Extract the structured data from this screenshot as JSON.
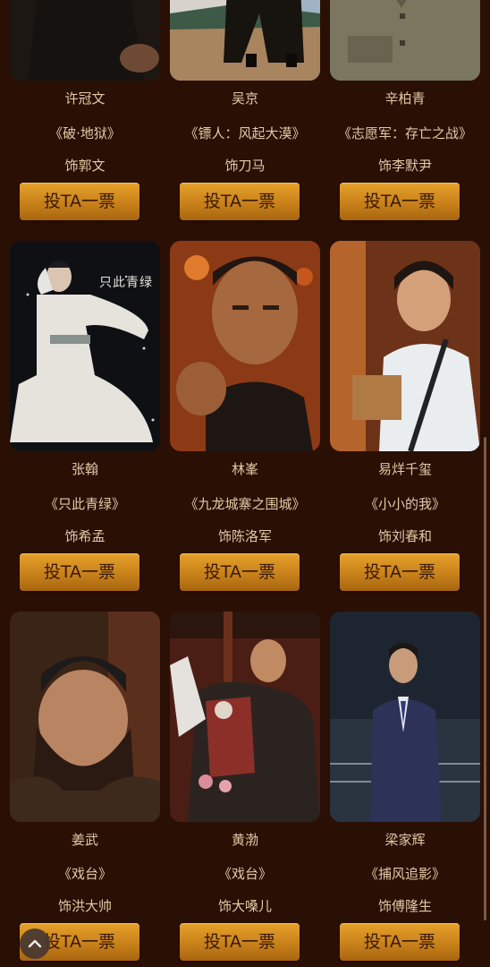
{
  "vote_label": "投TA一票",
  "cards": [
    {
      "name": "许冠文",
      "work": "《破·地狱》",
      "role": "饰郭文"
    },
    {
      "name": "吴京",
      "work": "《镖人：风起大漠》",
      "role": "饰刀马"
    },
    {
      "name": "辛柏青",
      "work": "《志愿军：存亡之战》",
      "role": "饰李默尹"
    },
    {
      "name": "张翰",
      "work": "《只此青绿》",
      "role": "饰希孟"
    },
    {
      "name": "林峯",
      "work": "《九龙城寨之围城》",
      "role": "饰陈洛军"
    },
    {
      "name": "易烊千玺",
      "work": "《小小的我》",
      "role": "饰刘春和"
    },
    {
      "name": "姜武",
      "work": "《戏台》",
      "role": "饰洪大帅"
    },
    {
      "name": "黄渤",
      "work": "《戏台》",
      "role": "饰大嗓儿"
    },
    {
      "name": "梁家辉",
      "work": "《捕风追影》",
      "role": "饰傅隆生"
    }
  ],
  "poster_text": "只此青绿",
  "colors": {
    "background": "#2a0f05",
    "text": "#e3c9a6",
    "button_gold": "#d08a1f",
    "button_text": "#3a1906"
  },
  "icons": {
    "back_to_top": "chevron-up-icon"
  }
}
